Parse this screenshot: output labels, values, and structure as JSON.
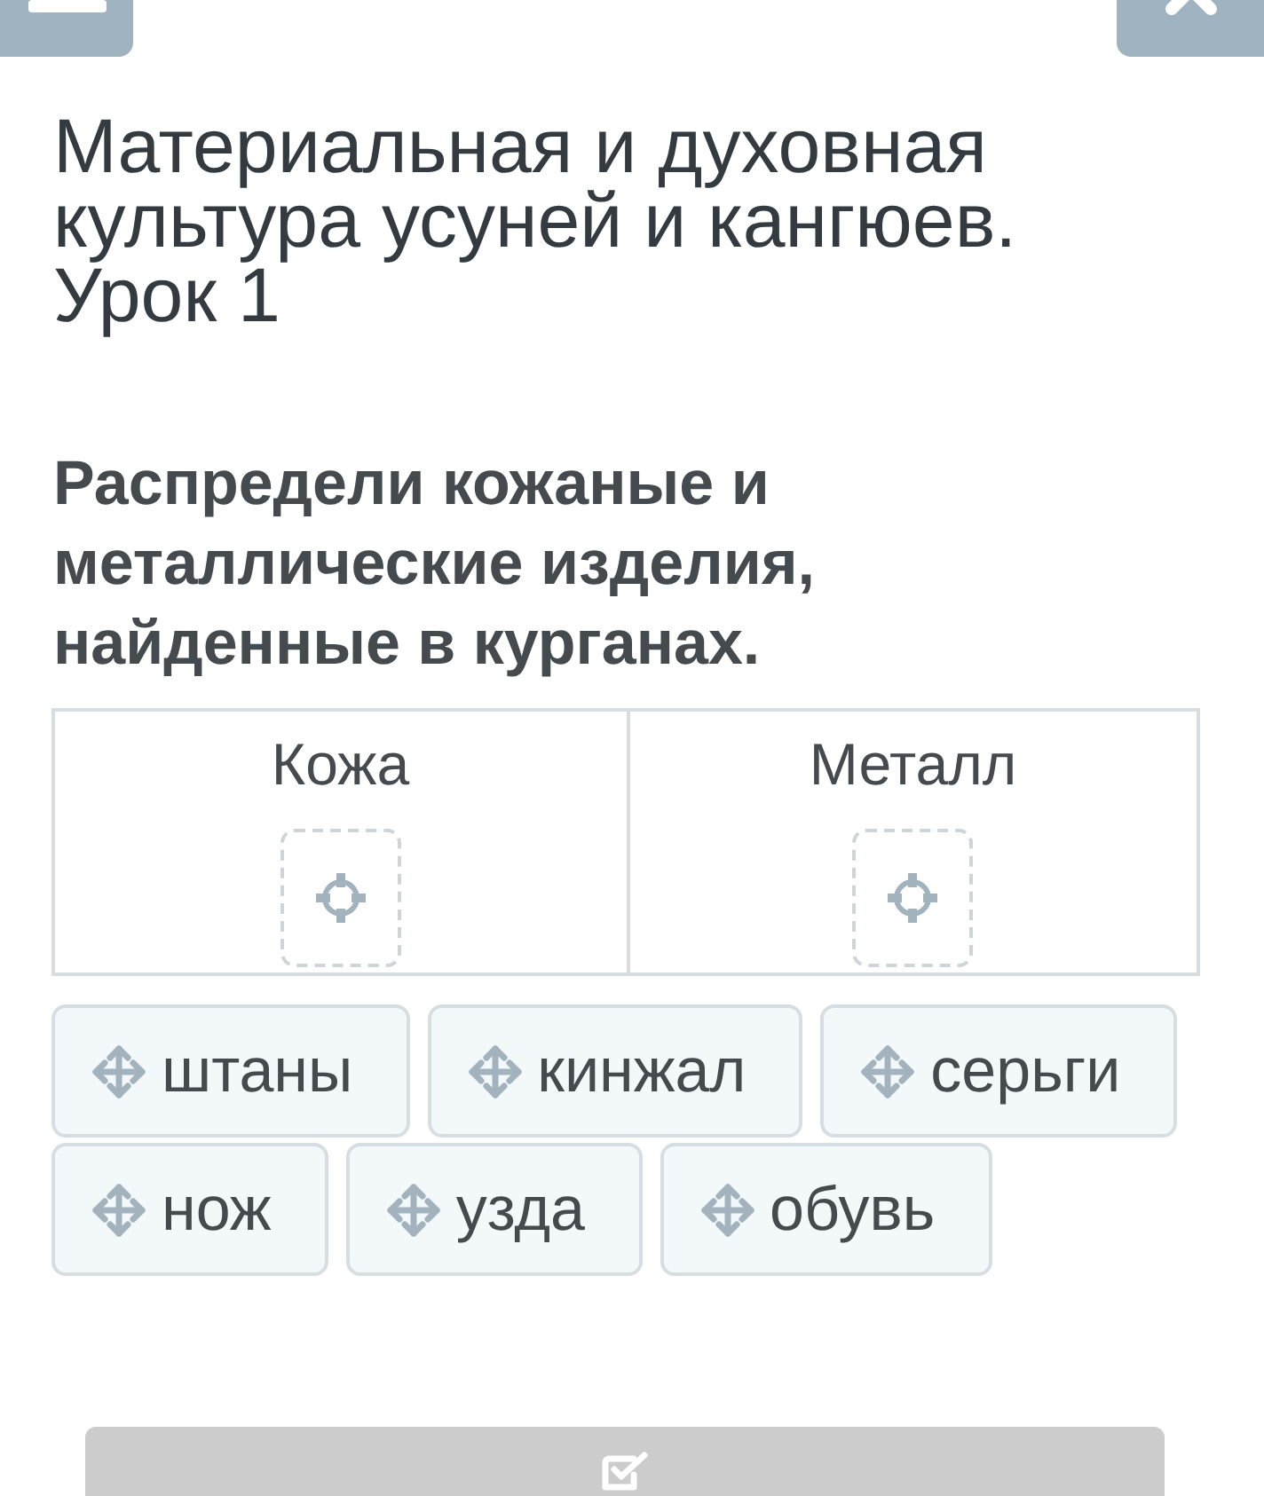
{
  "title": "Материальная и духовная культура усуней и кангюев. Урок 1",
  "question": "Распредели кожаные и металлические изделия, найденные в курганах.",
  "categories": [
    {
      "label": "Кожа"
    },
    {
      "label": "Металл"
    }
  ],
  "items": [
    {
      "label": "штаны"
    },
    {
      "label": "кинжал"
    },
    {
      "label": "серьги"
    },
    {
      "label": "нож"
    },
    {
      "label": "узда"
    },
    {
      "label": "обувь"
    }
  ],
  "check_button": {
    "disabled": true
  }
}
